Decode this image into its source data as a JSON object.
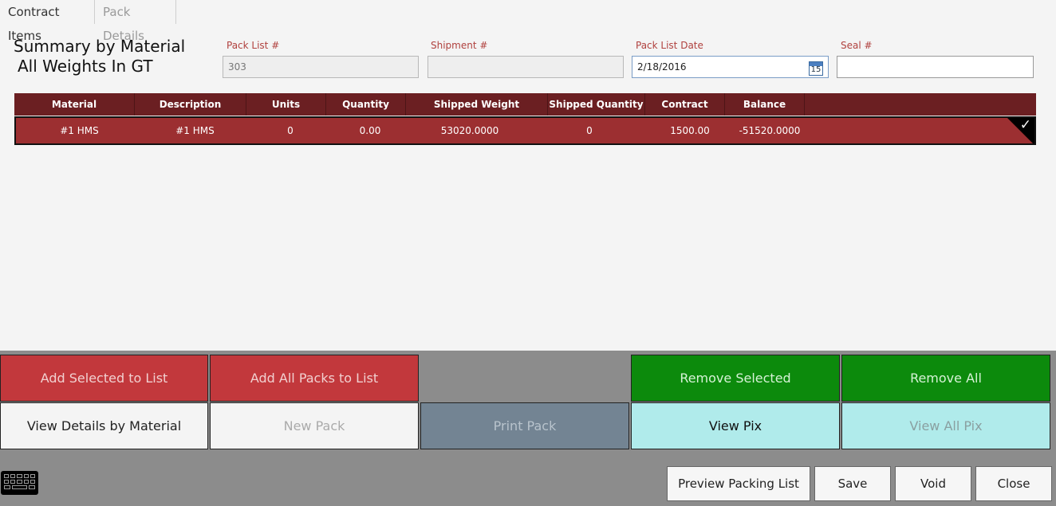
{
  "tabs": [
    {
      "label": "Contract Items"
    },
    {
      "label": "Pack Details"
    }
  ],
  "summary": {
    "line1": "Summary by Material",
    "line2": "All Weights In GT"
  },
  "fields": {
    "pack_list": {
      "label": "Pack List #",
      "value": "303"
    },
    "shipment": {
      "label": "Shipment #",
      "value": ""
    },
    "pack_list_date": {
      "label": "Pack List Date",
      "value": "2/18/2016",
      "calendar_day": "15"
    },
    "seal": {
      "label": "Seal #",
      "value": ""
    }
  },
  "grid": {
    "columns": [
      "Material",
      "Description",
      "Units",
      "Quantity",
      "Shipped Weight",
      "Shipped Quantity",
      "Contract",
      "Balance"
    ],
    "rows": [
      {
        "material": "#1 HMS",
        "description": "#1 HMS",
        "units": "0",
        "quantity": "0.00",
        "shipped_weight": "53020.0000",
        "shipped_quantity": "0",
        "contract": "1500.00",
        "balance": "-51520.0000"
      }
    ]
  },
  "buttons": {
    "add_selected": "Add Selected to List",
    "add_all_packs": "Add All Packs to List",
    "remove_selected": "Remove Selected",
    "remove_all": "Remove All",
    "view_details": "View Details by Material",
    "new_pack": "New Pack",
    "print_pack": "Print Pack",
    "view_pix": "View Pix",
    "view_all_pix": "View All Pix"
  },
  "footer": {
    "preview": "Preview Packing List",
    "save": "Save",
    "void": "Void",
    "close": "Close"
  },
  "colors": {
    "accent_red": "#c2383c",
    "grid_header": "#6b1f22",
    "grid_row": "#9c2f31",
    "green": "#0c8a0c",
    "cyan": "#b0ebeb"
  }
}
